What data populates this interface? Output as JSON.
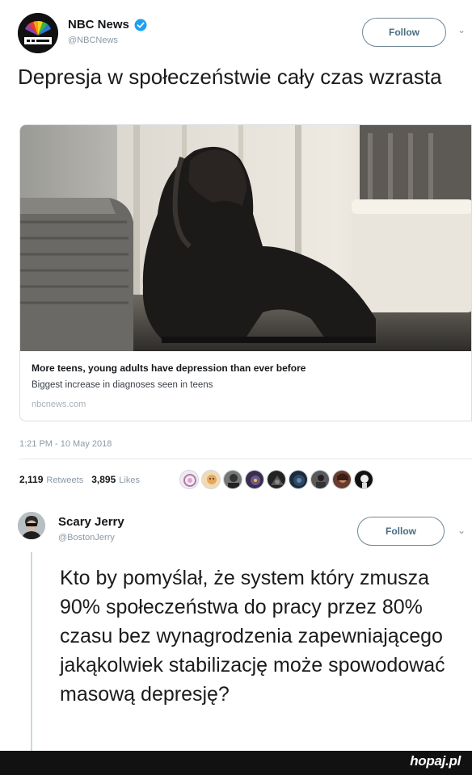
{
  "tweet": {
    "author_name": "NBC News",
    "author_handle": "@NBCNews",
    "follow_label": "Follow",
    "text": "Depresja w społeczeństwie cały czas wzrasta",
    "card": {
      "title": "More teens, young adults have depression than ever before",
      "description": "Biggest increase in diagnoses seen in teens",
      "domain": "nbcnews.com",
      "image_icon": "photo-person-sitting-head-in-hands"
    },
    "timestamp": "1:21 PM - 10 May 2018",
    "retweets_count": "2,119",
    "retweets_label": "Retweets",
    "likes_count": "3,895",
    "likes_label": "Likes",
    "liker_avatar_count": 9
  },
  "reply": {
    "author_name": "Scary Jerry",
    "author_handle": "@BostonJerry",
    "follow_label": "Follow",
    "text": "Kto by pomyślał, że system który zmusza 90% społeczeństwa do pracy przez 80% czasu bez wynagrodzenia zapewniającego jakąkolwiek stabilizację może spowodować masową depresję?"
  },
  "footer": {
    "watermark_main": "hopaj",
    "watermark_tld": ".pl"
  },
  "colors": {
    "accent": "#1da1f2",
    "follow_border": "#6f8796",
    "muted_text": "#8a9aa8",
    "footer_bg": "#111111"
  }
}
